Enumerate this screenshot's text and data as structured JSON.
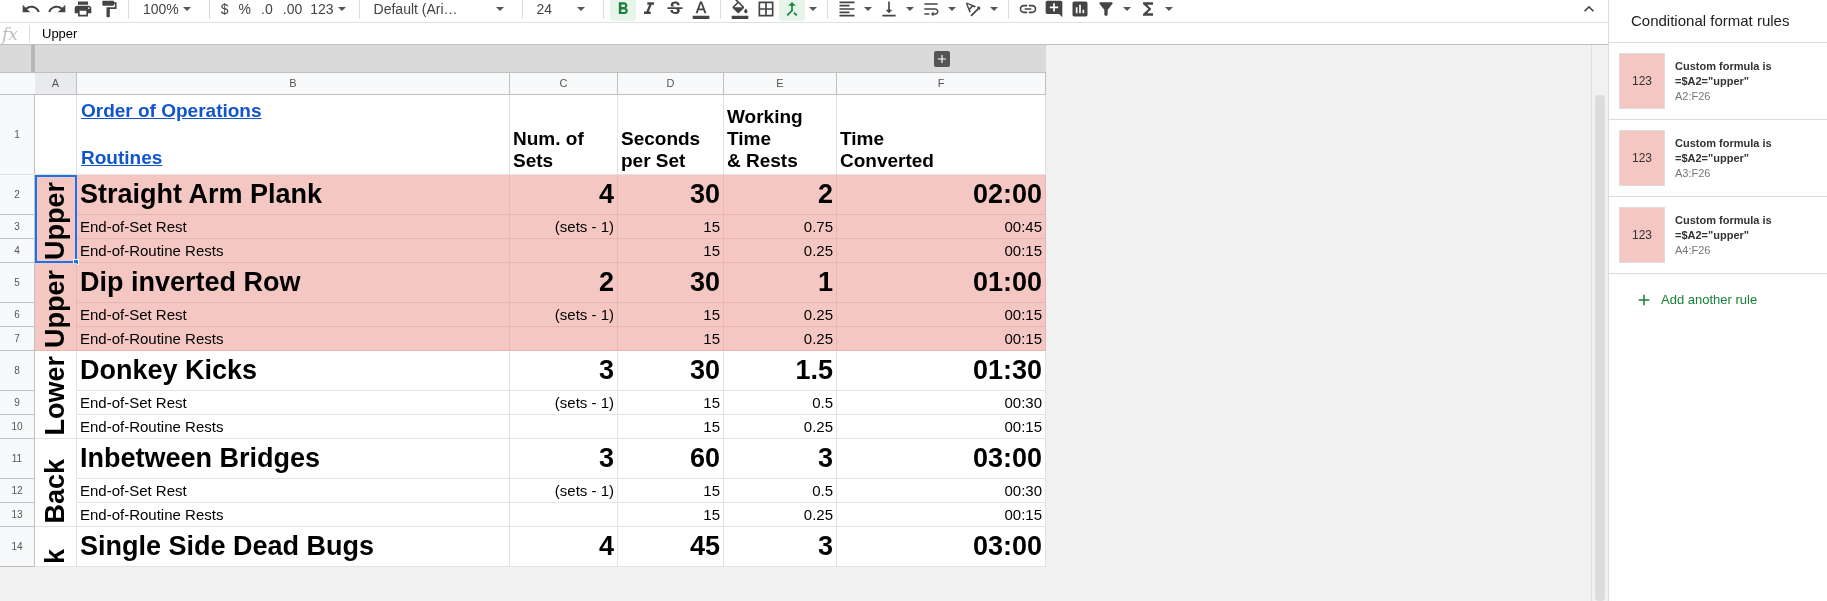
{
  "toolbar": {
    "zoom": "100%",
    "currency": "$",
    "percent": "%",
    "decrease_decimal": ".0",
    "increase_decimal": ".00",
    "number_format": "123",
    "font": "Default (Ari…",
    "font_size": "24",
    "bold": {
      "on": true
    },
    "merge": {
      "on": true
    }
  },
  "formula_bar": {
    "fx": "fx",
    "value": "Upper"
  },
  "columns": [
    "A",
    "B",
    "C",
    "D",
    "E",
    "F"
  ],
  "header_row": {
    "row": "1",
    "links": [
      "Order of Operations",
      "Routines"
    ],
    "headings": [
      "Num. of\nSets",
      "Seconds\nper Set",
      "Working\nTime\n& Rests",
      "Time\nConverted"
    ]
  },
  "groups": [
    {
      "label": "Upper",
      "selected": true,
      "highlighted": true,
      "rows": [
        {
          "row": "2",
          "kind": "exercise",
          "name": "Straight Arm Plank",
          "sets": "4",
          "seconds": "30",
          "working": "2",
          "time": "02:00"
        },
        {
          "row": "3",
          "kind": "rest",
          "name": "End-of-Set Rest",
          "sets": "(sets - 1)",
          "seconds": "15",
          "working": "0.75",
          "time": "00:45"
        },
        {
          "row": "4",
          "kind": "rest",
          "name": "End-of-Routine Rests",
          "seconds": "15",
          "working": "0.25",
          "time": "00:15"
        }
      ]
    },
    {
      "label": "Upper",
      "selected": false,
      "highlighted": true,
      "rows": [
        {
          "row": "5",
          "kind": "exercise",
          "name": "Dip inverted Row",
          "sets": "2",
          "seconds": "30",
          "working": "1",
          "time": "01:00"
        },
        {
          "row": "6",
          "kind": "rest",
          "name": "End-of-Set Rest",
          "sets": "(sets - 1)",
          "seconds": "15",
          "working": "0.25",
          "time": "00:15"
        },
        {
          "row": "7",
          "kind": "rest",
          "name": "End-of-Routine Rests",
          "seconds": "15",
          "working": "0.25",
          "time": "00:15"
        }
      ]
    },
    {
      "label": "Lower",
      "selected": false,
      "highlighted": false,
      "rows": [
        {
          "row": "8",
          "kind": "exercise",
          "name": "Donkey Kicks",
          "sets": "3",
          "seconds": "30",
          "working": "1.5",
          "time": "01:30"
        },
        {
          "row": "9",
          "kind": "rest",
          "name": "End-of-Set Rest",
          "sets": "(sets - 1)",
          "seconds": "15",
          "working": "0.5",
          "time": "00:30"
        },
        {
          "row": "10",
          "kind": "rest",
          "name": "End-of-Routine Rests",
          "seconds": "15",
          "working": "0.25",
          "time": "00:15"
        }
      ]
    },
    {
      "label": "Back",
      "selected": false,
      "highlighted": false,
      "rows": [
        {
          "row": "11",
          "kind": "exercise",
          "name": "Inbetween Bridges",
          "sets": "3",
          "seconds": "60",
          "working": "3",
          "time": "03:00"
        },
        {
          "row": "12",
          "kind": "rest",
          "name": "End-of-Set Rest",
          "sets": "(sets - 1)",
          "seconds": "15",
          "working": "0.5",
          "time": "00:30"
        },
        {
          "row": "13",
          "kind": "rest",
          "name": "End-of-Routine Rests",
          "seconds": "15",
          "working": "0.25",
          "time": "00:15"
        }
      ]
    },
    {
      "label": "k",
      "selected": false,
      "highlighted": false,
      "rows": [
        {
          "row": "14",
          "kind": "exercise",
          "name": "Single Side Dead Bugs",
          "sets": "4",
          "seconds": "45",
          "working": "3",
          "time": "03:00"
        }
      ]
    }
  ],
  "panel": {
    "title": "Conditional format rules",
    "rules": [
      {
        "preview": "123",
        "color": "#f4c7c3",
        "condition": "Custom formula is",
        "formula": "=$A2=\"upper\"",
        "range": "A2:F26"
      },
      {
        "preview": "123",
        "color": "#f4c7c3",
        "condition": "Custom formula is",
        "formula": "=$A2=\"upper\"",
        "range": "A3:F26"
      },
      {
        "preview": "123",
        "color": "#f4c7c3",
        "condition": "Custom formula is",
        "formula": "=$A2=\"upper\"",
        "range": "A4:F26"
      }
    ],
    "add_rule": "Add another rule"
  }
}
